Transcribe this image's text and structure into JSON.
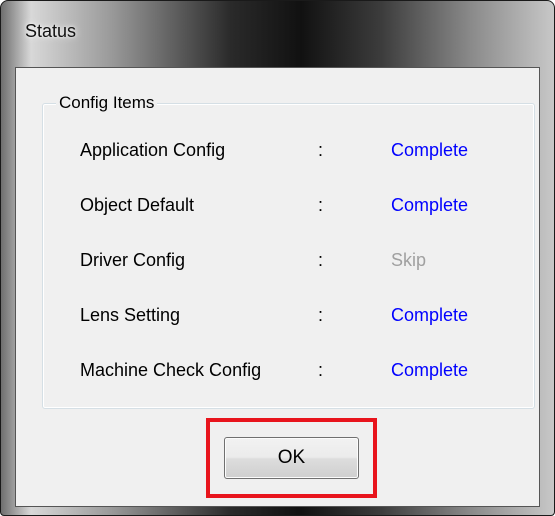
{
  "window": {
    "title": "Status"
  },
  "group": {
    "label": "Config Items"
  },
  "items": [
    {
      "label": "Application Config",
      "separator": ":",
      "status": "Complete"
    },
    {
      "label": "Object Default",
      "separator": ":",
      "status": "Complete"
    },
    {
      "label": "Driver Config",
      "separator": ":",
      "status": "Skip"
    },
    {
      "label": "Lens Setting",
      "separator": ":",
      "status": "Complete"
    },
    {
      "label": "Machine Check Config",
      "separator": ":",
      "status": "Complete"
    }
  ],
  "buttons": {
    "ok_label": "OK"
  },
  "colors": {
    "complete": "#0000ff",
    "skip": "#a0a0a0",
    "highlight": "#e8141c"
  }
}
